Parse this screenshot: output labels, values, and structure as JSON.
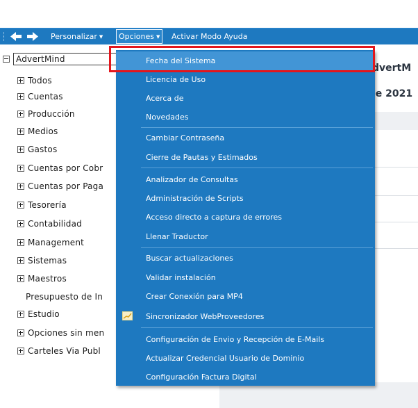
{
  "toolbar": {
    "items": [
      {
        "label": "Personalizar",
        "has_caret": true
      },
      {
        "label": "Opciones",
        "has_caret": true
      },
      {
        "label": "Activar Modo Ayuda",
        "has_caret": false
      }
    ],
    "back_icon": "arrow-left-icon",
    "forward_icon": "arrow-right-icon"
  },
  "tree": {
    "root": "AdvertMind",
    "items": [
      {
        "label": "Todos",
        "expandable": true
      },
      {
        "label": "Cuentas",
        "expandable": true
      },
      {
        "label": "Producción",
        "expandable": true
      },
      {
        "label": "Medios",
        "expandable": true
      },
      {
        "label": "Gastos",
        "expandable": true
      },
      {
        "label": "Cuentas por Cobr",
        "expandable": true
      },
      {
        "label": "Cuentas por Paga",
        "expandable": true
      },
      {
        "label": "Tesorería",
        "expandable": true
      },
      {
        "label": "Contabilidad",
        "expandable": true
      },
      {
        "label": "Management",
        "expandable": true
      },
      {
        "label": "Sistemas",
        "expandable": true
      },
      {
        "label": "Maestros",
        "expandable": true
      },
      {
        "label": "Presupuesto de In",
        "expandable": false
      },
      {
        "label": "Estudio",
        "expandable": true
      },
      {
        "label": "Opciones sin men",
        "expandable": true
      },
      {
        "label": "Carteles Via Publ",
        "expandable": true
      }
    ]
  },
  "right_panel": {
    "title_fragment": "dvertM",
    "date_fragment": "le 2021"
  },
  "options_menu": {
    "items": [
      {
        "label": "Fecha del Sistema",
        "highlighted": true
      },
      {
        "label": "Licencia de Uso"
      },
      {
        "label": "Acerca de"
      },
      {
        "label": "Novedades"
      },
      {
        "label": "Cambiar Contraseña"
      },
      {
        "label": "Cierre de Pautas y Estimados"
      },
      {
        "label": "Analizador de Consultas"
      },
      {
        "label": "Administración de Scripts"
      },
      {
        "label": "Acceso directo a captura de errores"
      },
      {
        "label": "Llenar Traductor"
      },
      {
        "label": "Buscar actualizaciones"
      },
      {
        "label": "Validar instalación"
      },
      {
        "label": "Crear Conexión para MP4"
      },
      {
        "label": "Sincronizador WebProveedores",
        "icon": "chart-line-icon"
      },
      {
        "label": "Configuración de Envio y Recepción de E-Mails"
      },
      {
        "label": "Actualizar Credencial Usuario de Dominio"
      },
      {
        "label": "Configuración Factura Digital"
      }
    ]
  },
  "colors": {
    "toolbar_blue": "#1e79c0",
    "menu_hover": "#4295d6",
    "annotation_red": "#e3161c"
  }
}
